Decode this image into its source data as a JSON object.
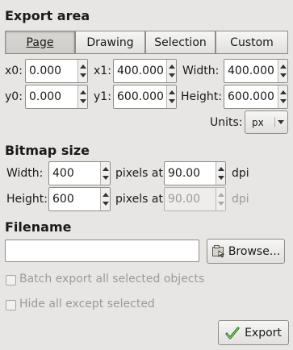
{
  "export_area": {
    "title": "Export area",
    "tabs": [
      {
        "label": "Page",
        "active": true
      },
      {
        "label": "Drawing",
        "active": false
      },
      {
        "label": "Selection",
        "active": false
      },
      {
        "label": "Custom",
        "active": false
      }
    ],
    "x0": {
      "label": "x0:",
      "value": "0.000"
    },
    "x1": {
      "label": "x1:",
      "value": "400.000"
    },
    "width": {
      "label": "Width:",
      "value": "400.000"
    },
    "y0": {
      "label": "y0:",
      "value": "0.000"
    },
    "y1": {
      "label": "y1:",
      "value": "600.000"
    },
    "height": {
      "label": "Height:",
      "value": "600.000"
    },
    "units": {
      "label": "Units:",
      "value": "px"
    }
  },
  "bitmap": {
    "title": "Bitmap size",
    "width": {
      "label": "Width:",
      "value": "400",
      "dpi": "90.00"
    },
    "height": {
      "label": "Height:",
      "value": "600",
      "dpi": "90.00"
    },
    "pixels_at": "pixels at",
    "dpi_label": "dpi"
  },
  "filename": {
    "title": "Filename",
    "value": "",
    "browse_label": "Browse..."
  },
  "options": {
    "batch_export": {
      "label": "Batch export all selected objects",
      "checked": false
    },
    "hide_all": {
      "label": "Hide all except selected",
      "checked": false
    }
  },
  "export_button": {
    "label": "Export"
  }
}
